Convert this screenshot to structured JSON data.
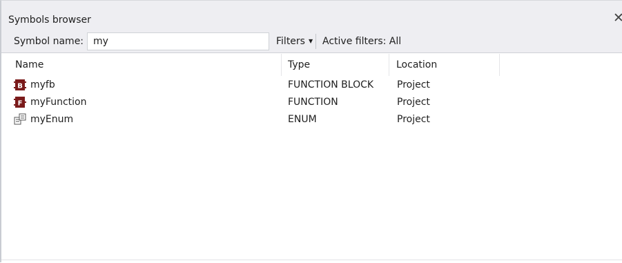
{
  "window": {
    "title": "Symbols browser",
    "close_glyph": "✕"
  },
  "toolbar": {
    "symbol_name_label": "Symbol name:",
    "symbol_name_value": "my",
    "filters_label": "Filters",
    "active_filters_label": "Active filters: All"
  },
  "table": {
    "columns": [
      "Name",
      "Type",
      "Location"
    ],
    "rows": [
      {
        "name": "myfb",
        "type": "FUNCTION BLOCK",
        "location": "Project",
        "icon": "function-block-icon"
      },
      {
        "name": "myFunction",
        "type": "FUNCTION",
        "location": "Project",
        "icon": "function-icon"
      },
      {
        "name": "myEnum",
        "type": "ENUM",
        "location": "Project",
        "icon": "enum-icon"
      }
    ]
  },
  "colors": {
    "icon_dark_red": "#7a1a1a",
    "chrome": "#eeeef2"
  }
}
